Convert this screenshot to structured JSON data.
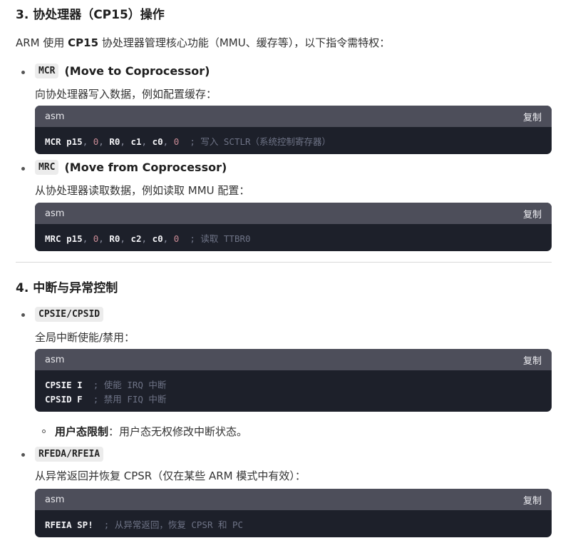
{
  "section3": {
    "heading": "3. 协处理器（CP15）操作",
    "intro_prefix": "ARM 使用 ",
    "intro_bold": "CP15",
    "intro_suffix": " 协处理器管理核心功能（MMU、缓存等），以下指令需特权：",
    "items": [
      {
        "code": "MCR",
        "title": "(Move to Coprocessor)",
        "desc": "向协处理器写入数据，例如配置缓存：",
        "block": {
          "lang": "asm",
          "copy": "复制",
          "lines": [
            {
              "kw": "MCR",
              "ops": "p15",
              "n1": "0",
              "r": "R0",
              "c1": "c1",
              "c2": "c0",
              "n2": "0",
              "comment": "; 写入 SCTLR（系统控制寄存器）"
            }
          ]
        }
      },
      {
        "code": "MRC",
        "title": "(Move from Coprocessor)",
        "desc": "从协处理器读取数据，例如读取 MMU 配置：",
        "block": {
          "lang": "asm",
          "copy": "复制",
          "lines": [
            {
              "kw": "MRC",
              "ops": "p15",
              "n1": "0",
              "r": "R0",
              "c1": "c2",
              "c2": "c0",
              "n2": "0",
              "comment": "; 读取 TTBR0"
            }
          ]
        }
      }
    ]
  },
  "section4": {
    "heading": "4. 中断与异常控制",
    "items": [
      {
        "code": "CPSIE/CPSID",
        "desc": "全局中断使能/禁用：",
        "block": {
          "lang": "asm",
          "copy": "复制",
          "lines": [
            {
              "instr": "CPSIE I",
              "comment": "; 使能 IRQ 中断"
            },
            {
              "instr": "CPSID F",
              "comment": "; 禁用 FIQ 中断"
            }
          ]
        },
        "sub": {
          "bold": "用户态限制",
          "text": "：用户态无权修改中断状态。"
        }
      },
      {
        "code": "RFEDA/RFEIA",
        "desc": "从异常返回并恢复 CPSR（仅在某些 ARM 模式中有效）：",
        "block": {
          "lang": "asm",
          "copy": "复制",
          "lines": [
            {
              "instr": "RFEIA SP!",
              "comment": "; 从异常返回，恢复 CPSR 和 PC"
            }
          ]
        }
      }
    ]
  }
}
